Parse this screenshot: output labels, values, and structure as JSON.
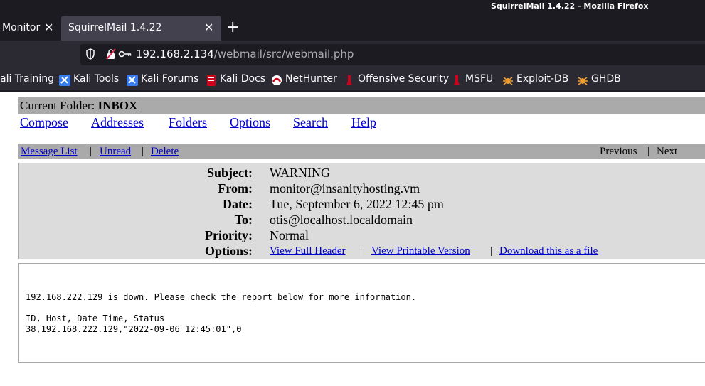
{
  "window": {
    "title": "SquirrelMail 1.4.22 - Mozilla Firefox"
  },
  "tabs": [
    {
      "label": "Monitor",
      "close": "✕"
    },
    {
      "label": "SquirrelMail 1.4.22",
      "close": "✕"
    }
  ],
  "new_tab": "+",
  "address": {
    "host": "192.168.2.134",
    "path": "/webmail/src/webmail.php"
  },
  "bookmarks": [
    {
      "label": "ali Training",
      "icon": "kali-dragon-icon"
    },
    {
      "label": "Kali Tools",
      "icon": "kali-tools-icon"
    },
    {
      "label": "Kali Forums",
      "icon": "kali-forums-icon"
    },
    {
      "label": "Kali Docs",
      "icon": "kali-docs-icon"
    },
    {
      "label": "NetHunter",
      "icon": "nethunter-icon"
    },
    {
      "label": "Offensive Security",
      "icon": "offsec-icon"
    },
    {
      "label": "MSFU",
      "icon": "offsec-icon"
    },
    {
      "label": "Exploit-DB",
      "icon": "exploit-db-icon"
    },
    {
      "label": "GHDB",
      "icon": "exploit-db-icon"
    }
  ],
  "mail": {
    "folder_label": "Current Folder:",
    "folder_name": "INBOX",
    "top_links": [
      "Compose",
      "Addresses",
      "Folders",
      "Options",
      "Search",
      "Help"
    ],
    "nav": {
      "message_list": "Message List",
      "unread": "Unread",
      "delete": "Delete",
      "sep": "|",
      "previous": "Previous",
      "next": "Next"
    },
    "headers": {
      "subject_label": "Subject:",
      "subject": "WARNING",
      "from_label": "From:",
      "from": "monitor@insanityhosting.vm",
      "date_label": "Date:",
      "date": "Tue, September 6, 2022 12:45 pm",
      "to_label": "To:",
      "to": "otis@localhost.localdomain",
      "priority_label": "Priority:",
      "priority": "Normal",
      "options_label": "Options:",
      "view_full_header": "View Full Header",
      "view_printable": "View Printable Version",
      "download": "Download this as a file"
    },
    "body": "192.168.222.129 is down. Please check the report below for more information.\n\nID, Host, Date Time, Status\n38,192.168.222.129,\"2022-09-06 12:45:01\",0"
  },
  "colors": {
    "chrome_dark": "#1c1b22",
    "chrome": "#2b2a33",
    "tab_active": "#42414d",
    "link": "#0000cc",
    "bar_gray": "#aaaaaa",
    "header_bg": "#dcdcdc"
  }
}
